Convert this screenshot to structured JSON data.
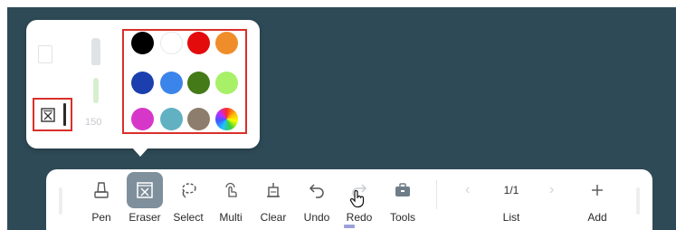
{
  "palette": {
    "eraser_size": "150",
    "colors": [
      [
        "#000000",
        "#ffffff",
        "#e30b0b",
        "#f08d2b"
      ],
      [
        "#1b3fae",
        "#3b84ea",
        "#447a17",
        "#a7f068"
      ],
      [
        "#d637c9",
        "#61b1c2",
        "#8c7d6c",
        "rainbow"
      ]
    ]
  },
  "toolbar": {
    "tools": [
      {
        "label": "Pen",
        "icon": "pen-icon",
        "active": false
      },
      {
        "label": "Eraser",
        "icon": "eraser-icon",
        "active": true
      },
      {
        "label": "Select",
        "icon": "lasso-icon",
        "active": false
      },
      {
        "label": "Multi",
        "icon": "multi-touch-icon",
        "active": false
      },
      {
        "label": "Clear",
        "icon": "clear-icon",
        "active": false
      },
      {
        "label": "Undo",
        "icon": "undo-icon",
        "active": false
      },
      {
        "label": "Redo",
        "icon": "redo-icon",
        "active": false
      },
      {
        "label": "Tools",
        "icon": "toolbox-icon",
        "active": false
      }
    ],
    "page_indicator": "1/1",
    "list_label": "List",
    "add_label": "Add",
    "accent": "#7f8f9c"
  }
}
